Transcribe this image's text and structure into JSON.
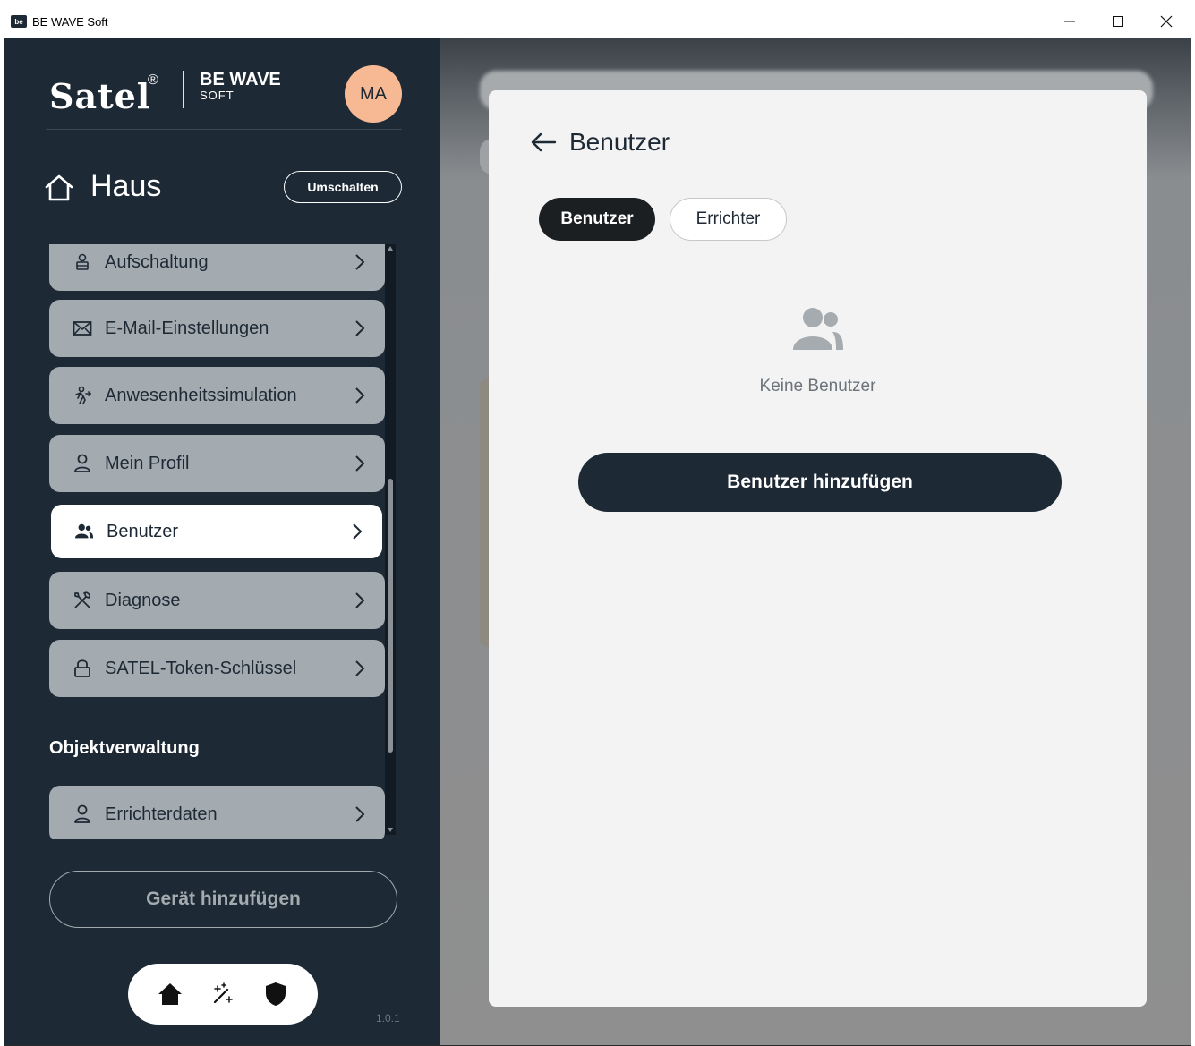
{
  "window": {
    "app_icon": "be",
    "title": "BE WAVE Soft",
    "controls": [
      "minimize-icon",
      "maximize-icon",
      "close-icon"
    ]
  },
  "sidebar": {
    "brand": {
      "logo": "Satel",
      "product": "BE WAVE",
      "product_sub": "SOFT"
    },
    "avatar_initials": "MA",
    "home": {
      "title": "Haus",
      "switch_label": "Umschalten"
    },
    "menu_items": [
      {
        "label": "Aufschaltung",
        "icon": "monitoring-icon"
      },
      {
        "label": "E-Mail-Einstellungen",
        "icon": "mail-icon"
      },
      {
        "label": "Anwesenheitssimulation",
        "icon": "presence-icon"
      },
      {
        "label": "Mein Profil",
        "icon": "profile-icon"
      },
      {
        "label": "Benutzer",
        "icon": "users-icon",
        "active": true
      },
      {
        "label": "Diagnose",
        "icon": "tools-icon"
      },
      {
        "label": "SATEL-Token-Schlüssel",
        "icon": "lock-icon"
      }
    ],
    "section_label": "Objektverwaltung",
    "section_items": [
      {
        "label": "Errichterdaten",
        "icon": "profile-icon"
      }
    ],
    "add_device_label": "Gerät hinzufügen",
    "bottom_nav": [
      "home-icon",
      "magic-wand-icon",
      "shield-icon"
    ],
    "version": "1.0.1"
  },
  "modal": {
    "title": "Benutzer",
    "tabs": [
      {
        "label": "Benutzer",
        "active": true
      },
      {
        "label": "Errichter",
        "active": false
      }
    ],
    "empty_text": "Keine Benutzer",
    "add_button_label": "Benutzer hinzufügen"
  },
  "colors": {
    "sidebar_bg": "#1d2934",
    "menu_item_bg": "#a4abb0",
    "avatar_bg": "#f7b993",
    "modal_bg": "#f3f3f3",
    "primary": "#1d2934"
  }
}
